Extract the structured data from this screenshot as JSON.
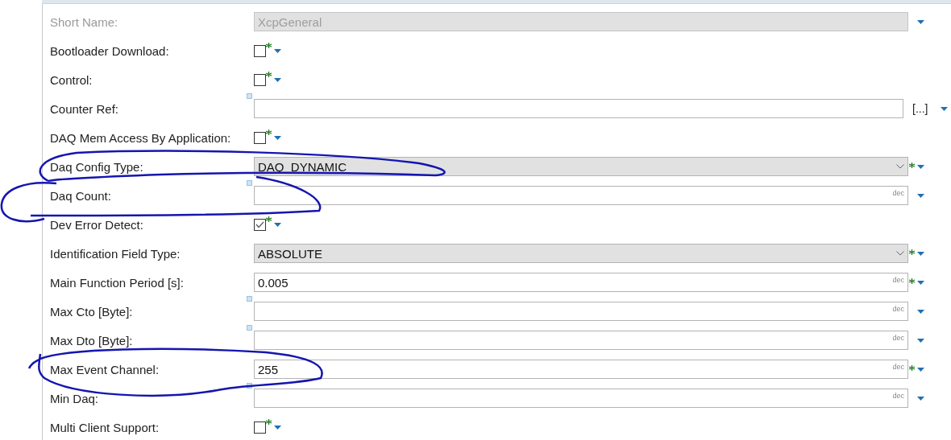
{
  "form": {
    "rows": [
      {
        "kind": "text",
        "label": "Short Name:",
        "value": "XcpGeneral",
        "disabled": true,
        "required": false,
        "unset_marker": false
      },
      {
        "kind": "checkbox",
        "label": "Bootloader Download:",
        "checked": false,
        "required": true
      },
      {
        "kind": "checkbox",
        "label": "Control:",
        "checked": false,
        "required": true
      },
      {
        "kind": "reference",
        "label": "Counter Ref:",
        "browse_label": "[...]",
        "required": false,
        "unset_marker": true
      },
      {
        "kind": "checkbox",
        "label": "DAQ Mem Access By Application:",
        "checked": false,
        "required": true
      },
      {
        "kind": "combo",
        "label": "Daq Config Type:",
        "value": "DAQ_DYNAMIC",
        "required": true,
        "unset_marker": false
      },
      {
        "kind": "number",
        "label": "Daq Count:",
        "unit": "dec",
        "required": false,
        "unset_marker": true
      },
      {
        "kind": "checkbox",
        "label": "Dev Error Detect:",
        "checked": true,
        "required": true
      },
      {
        "kind": "combo",
        "label": "Identification Field Type:",
        "value": "ABSOLUTE",
        "required": true,
        "unset_marker": false
      },
      {
        "kind": "number",
        "label": "Main Function Period [s]:",
        "value": "0.005",
        "unit": "dec",
        "required": true,
        "unset_marker": false
      },
      {
        "kind": "number",
        "label": "Max Cto [Byte]:",
        "unit": "dec",
        "required": false,
        "unset_marker": true
      },
      {
        "kind": "number",
        "label": "Max Dto [Byte]:",
        "unit": "dec",
        "required": false,
        "unset_marker": true
      },
      {
        "kind": "number",
        "label": "Max Event Channel:",
        "value": "255",
        "unit": "dec",
        "required": true,
        "unset_marker": false
      },
      {
        "kind": "number",
        "label": "Min Daq:",
        "unit": "dec",
        "required": false,
        "unset_marker": true
      },
      {
        "kind": "checkbox",
        "label": "Multi Client Support:",
        "checked": false,
        "required": true
      }
    ]
  }
}
